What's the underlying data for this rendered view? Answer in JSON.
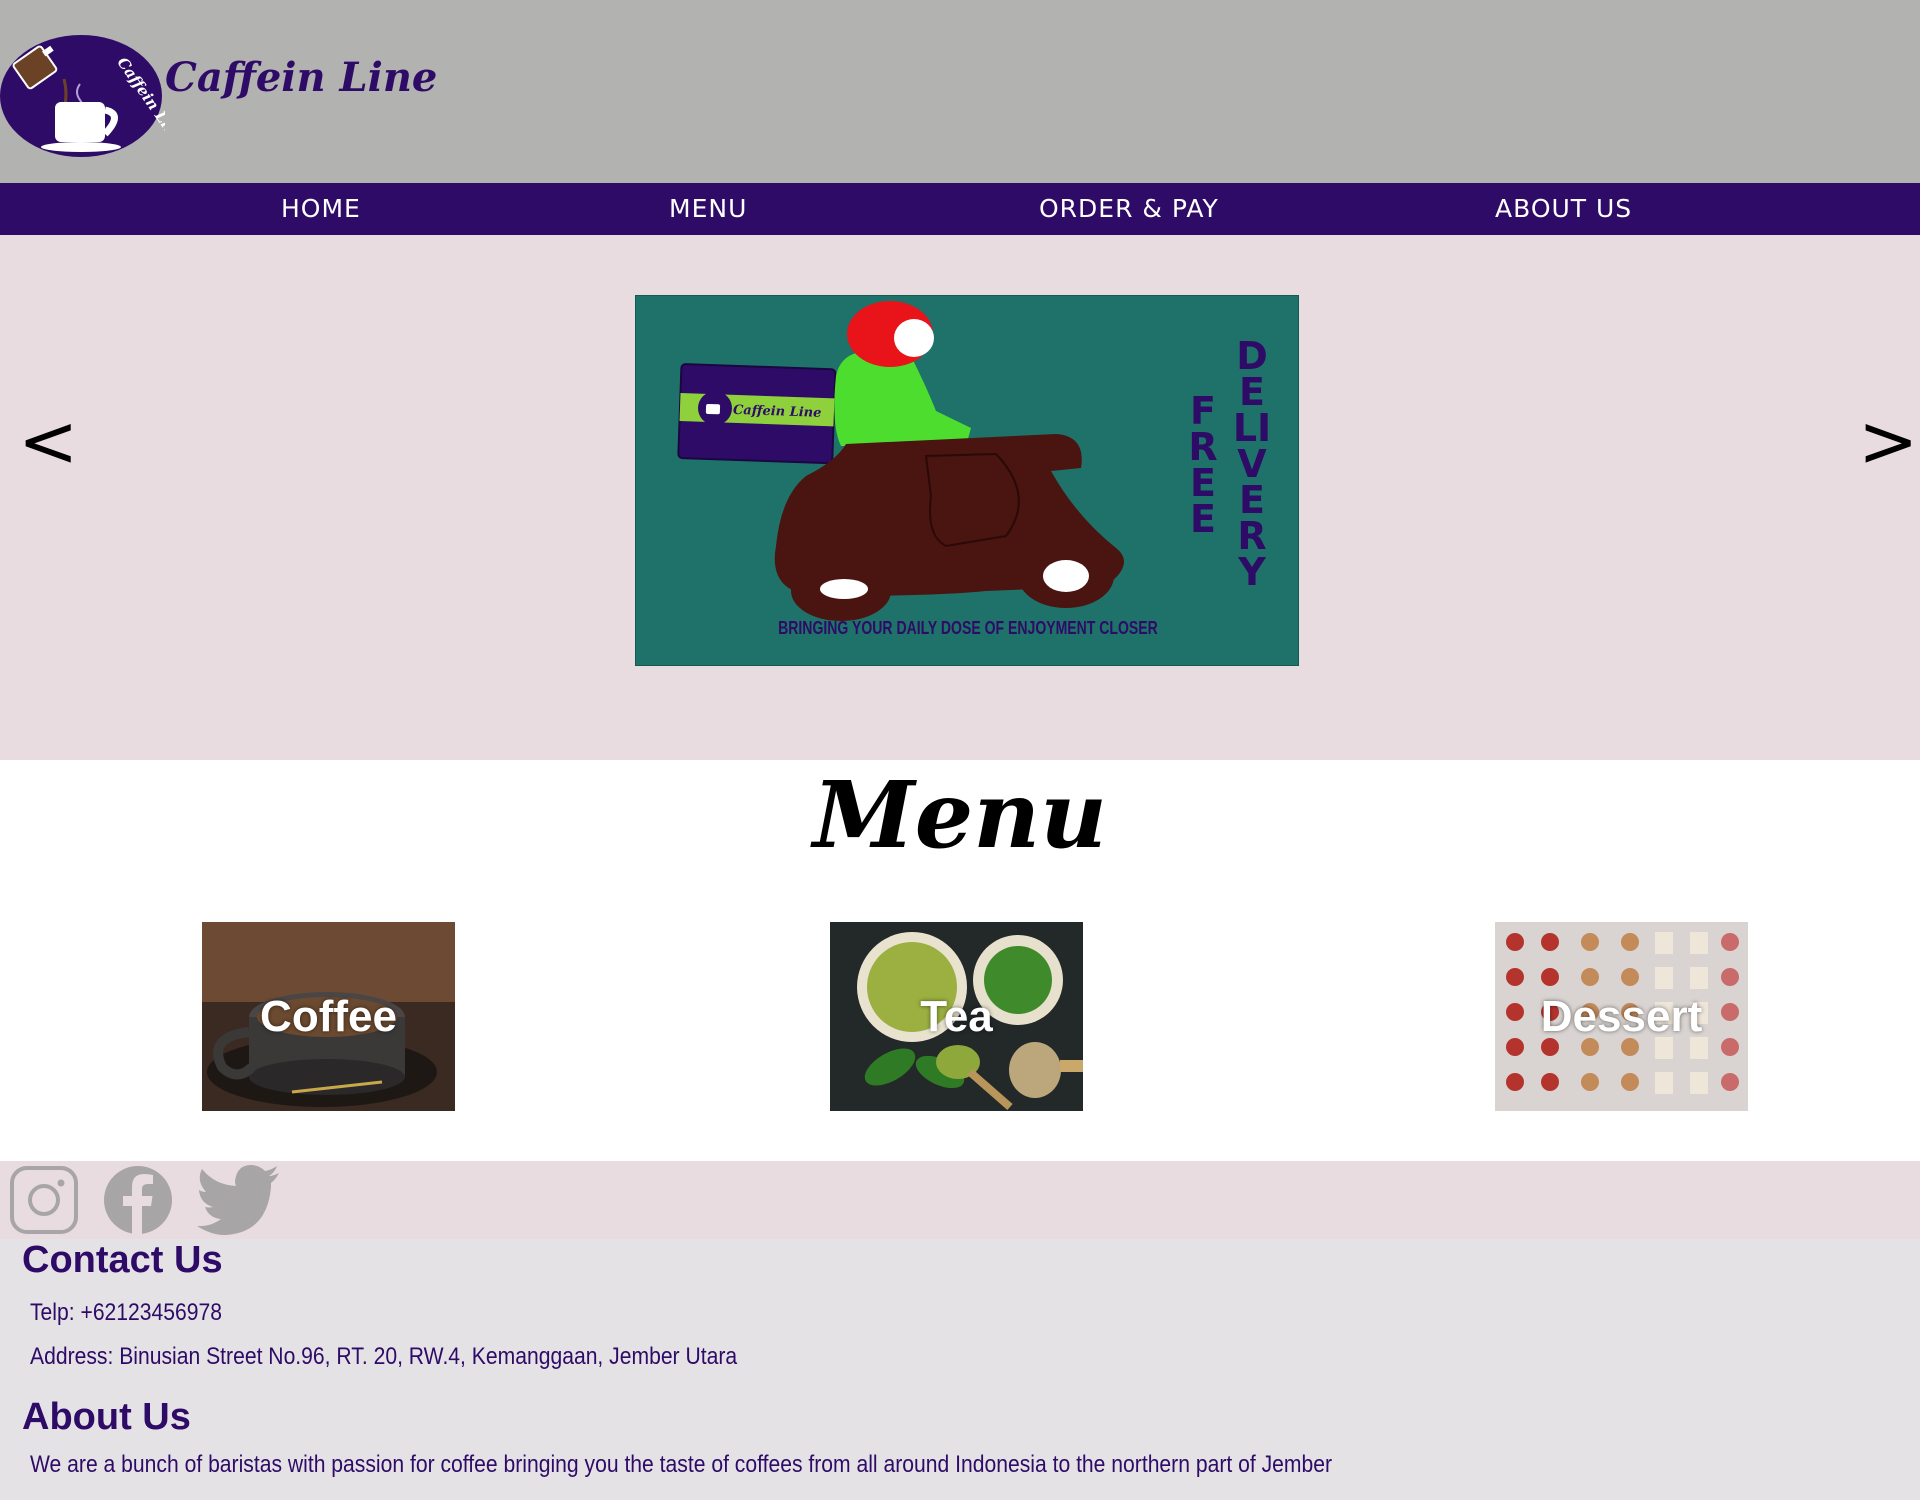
{
  "brand": {
    "name": "Caffein Line",
    "color": "#2e0b66"
  },
  "nav": {
    "items": [
      {
        "label": "HOME"
      },
      {
        "label": "MENU"
      },
      {
        "label": "ORDER & PAY"
      },
      {
        "label": "ABOUT US"
      }
    ]
  },
  "slider": {
    "prev_label": "<",
    "next_label": ">",
    "banner": {
      "word_free": "FREE",
      "word_delivery": "DELIVERY",
      "tagline": "BRINGING YOUR DAILY DOSE OF ENJOYMENT CLOSER",
      "box_logo_text": "Caffein Line"
    }
  },
  "menu": {
    "title": "Menu",
    "cards": [
      {
        "label": "Coffee"
      },
      {
        "label": "Tea"
      },
      {
        "label": "Dessert"
      }
    ]
  },
  "social": {
    "icons": [
      "instagram-icon",
      "facebook-icon",
      "twitter-icon"
    ]
  },
  "footer": {
    "contact_heading": "Contact Us",
    "phone": "Telp: +62123456978",
    "address": "Address: Binusian Street No.96, RT. 20, RW.4, Kemanggaan, Jember Utara",
    "about_heading": "About Us",
    "about_text": "We are a bunch of baristas with passion for coffee bringing you the taste of coffees from all around Indonesia to the northern part of Jember"
  }
}
